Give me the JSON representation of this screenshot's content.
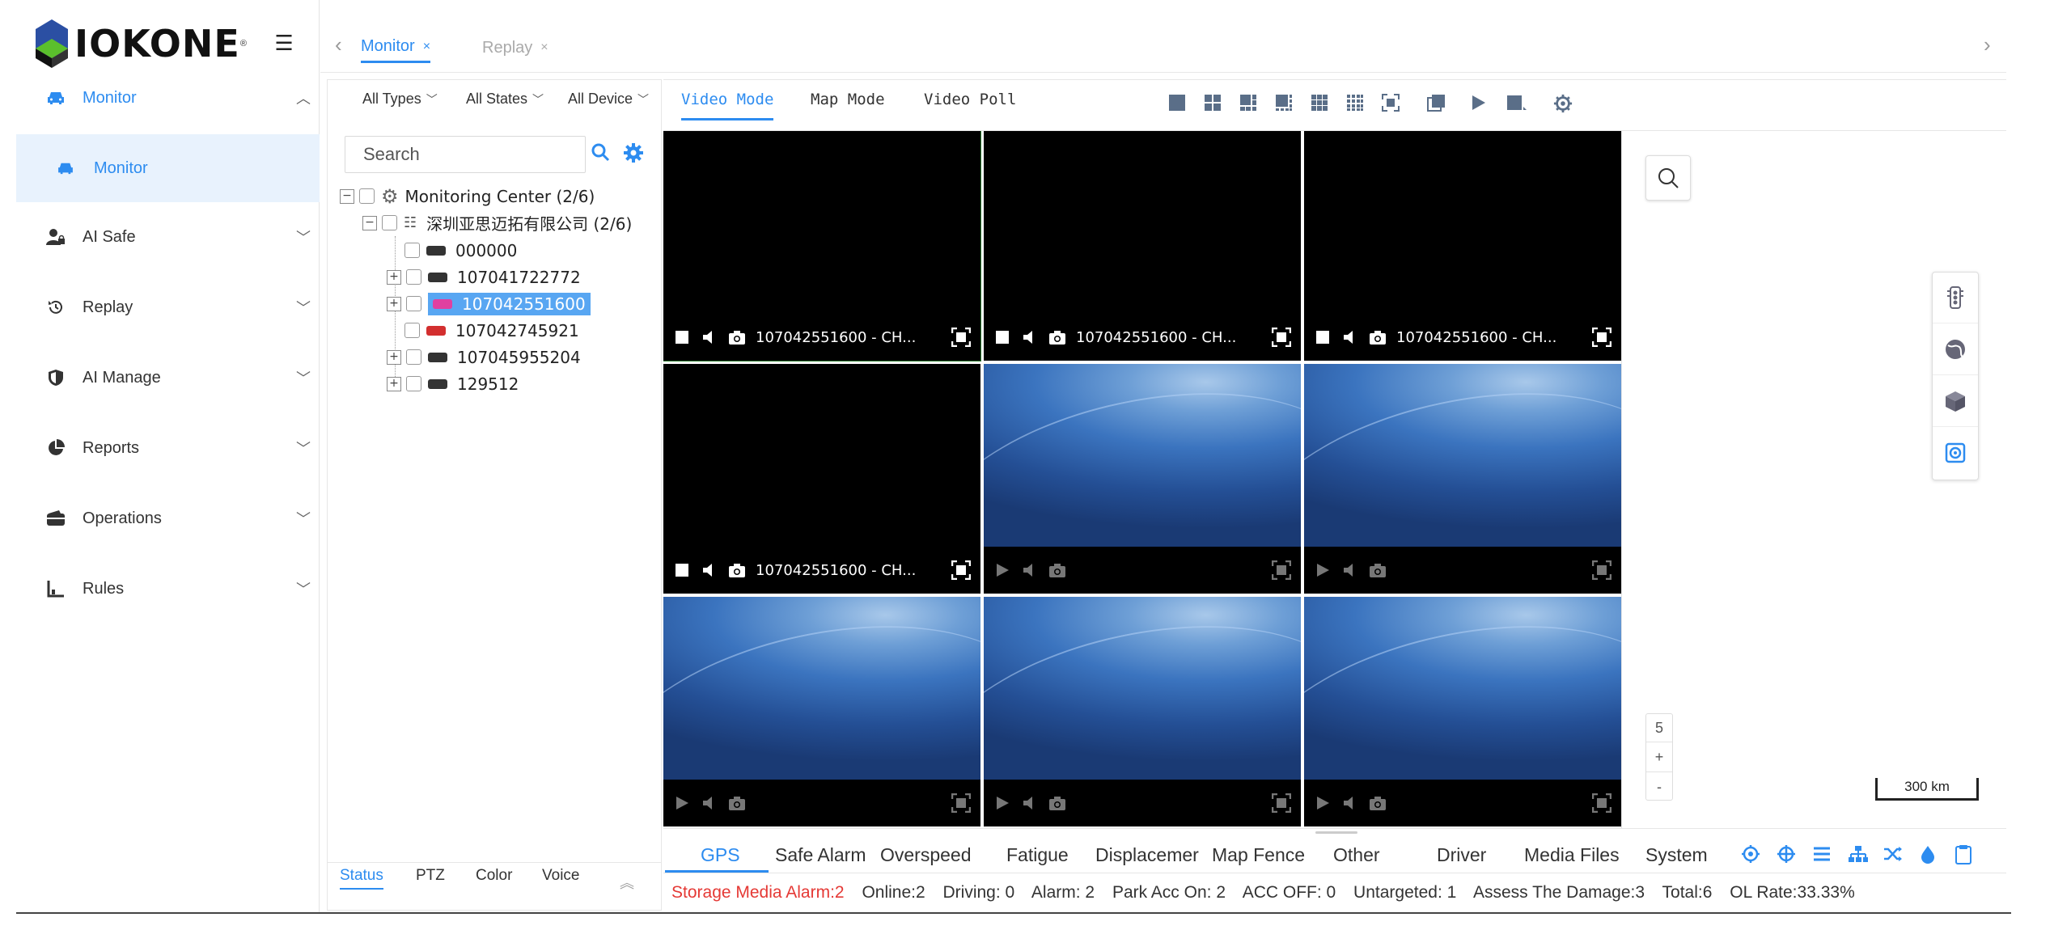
{
  "brand": {
    "name": "IOKONE",
    "reg": "®"
  },
  "sidebar": {
    "items": [
      {
        "label": "Monitor",
        "icon": "car-icon"
      },
      {
        "label": "AI Safe",
        "icon": "user-lock-icon"
      },
      {
        "label": "Replay",
        "icon": "history-icon"
      },
      {
        "label": "AI Manage",
        "icon": "shield-icon"
      },
      {
        "label": "Reports",
        "icon": "pie-chart-icon"
      },
      {
        "label": "Operations",
        "icon": "wallet-icon"
      },
      {
        "label": "Rules",
        "icon": "chart-axis-icon"
      }
    ],
    "subitem": {
      "label": "Monitor"
    }
  },
  "tabs": [
    {
      "label": "Monitor",
      "close": "×"
    },
    {
      "label": "Replay",
      "close": "×"
    }
  ],
  "filters": {
    "types": "All Types",
    "states": "All States",
    "device": "All Device"
  },
  "search": {
    "placeholder": "Search"
  },
  "tree": {
    "root": "Monitoring Center  (2/6)",
    "company": "深圳亚思迈拓有限公司  (2/6)",
    "devices": [
      "000000",
      "107041722772",
      "107042551600",
      "107042745921",
      "107045955204",
      "129512"
    ]
  },
  "bottom_left_tabs": [
    "Status",
    "PTZ",
    "Color",
    "Voice"
  ],
  "modes": [
    "Video Mode",
    "Map Mode",
    "Video Poll"
  ],
  "video": {
    "tile_label": "107042551600 - CH..."
  },
  "map": {
    "zoom_level": "5",
    "zoom_in": "+",
    "zoom_out": "-",
    "scale": "300 km"
  },
  "bottom_tabs": [
    "GPS",
    "Safe Alarm",
    "Overspeed",
    "Fatigue",
    "Displacemer",
    "Map Fence",
    "Other",
    "Driver",
    "Media Files",
    "System"
  ],
  "status": {
    "alarm": "Storage Media Alarm:2",
    "online": "Online:2",
    "driving": "Driving: 0",
    "alarm_count": "Alarm: 2",
    "park": "Park Acc On: 2",
    "acc_off": "ACC OFF: 0",
    "untargeted": "Untargeted: 1",
    "assess": "Assess The Damage:3",
    "total": "Total:6",
    "ol_rate": "OL Rate:33.33%"
  },
  "colors": {
    "accent": "#2d8cf0",
    "alarm": "#e53935",
    "selected_bg": "#58a6f2"
  }
}
